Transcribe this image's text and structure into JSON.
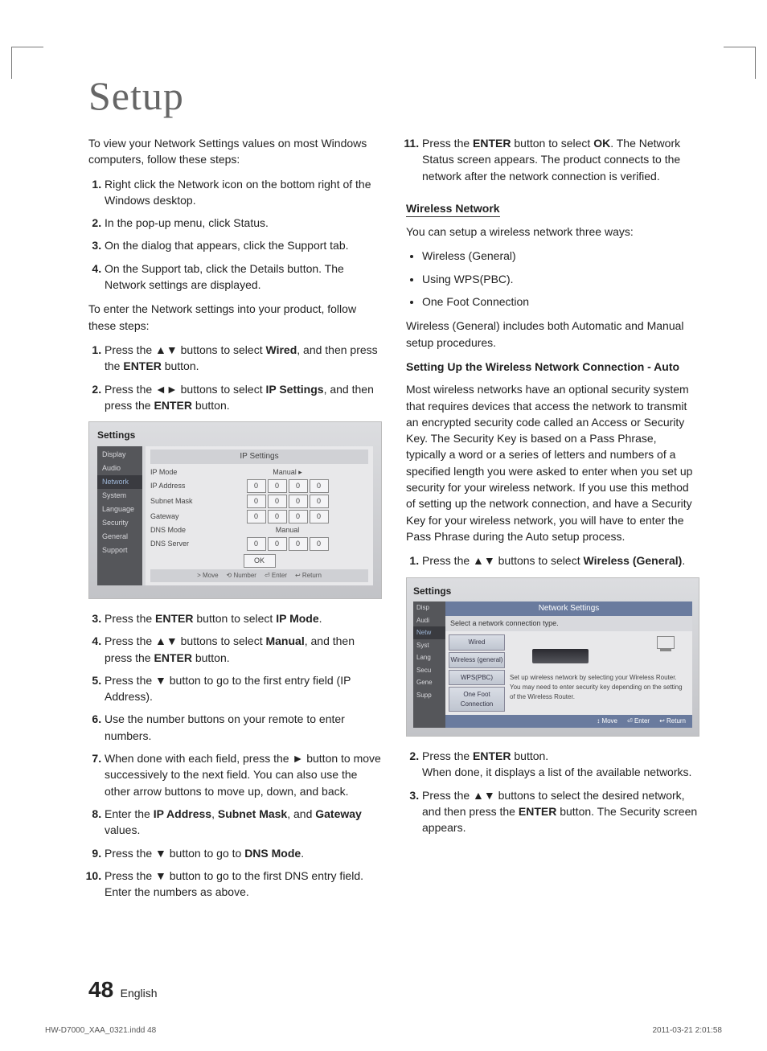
{
  "title": "Setup",
  "left": {
    "intro": "To view your Network Settings values on most Windows computers, follow these steps:",
    "steps_a": [
      "Right click the Network icon on the bottom right of the Windows desktop.",
      "In the pop-up menu, click Status.",
      "On the dialog that appears, click the Support tab.",
      "On the Support tab, click the Details button. The Network settings are displayed."
    ],
    "intro2": "To enter the Network settings into your product, follow these steps:",
    "step_b1_a": "Press the ▲▼ buttons to select ",
    "step_b1_b": "Wired",
    "step_b1_c": ", and then press the ",
    "step_b1_d": "ENTER",
    "step_b1_e": " button.",
    "step_b2_a": "Press the ◄► buttons to select ",
    "step_b2_b": "IP Settings",
    "step_b2_c": ", and then press the ",
    "step_b2_d": "ENTER",
    "step_b2_e": " button.",
    "step_b3_a": "Press the ",
    "step_b3_b": "ENTER",
    "step_b3_c": " button to select ",
    "step_b3_d": "IP Mode",
    "step_b3_e": ".",
    "step_b4_a": "Press the ▲▼ buttons to select ",
    "step_b4_b": "Manual",
    "step_b4_c": ", and then press the ",
    "step_b4_d": "ENTER",
    "step_b4_e": " button.",
    "step_b5": "Press the ▼ button to go to the first entry field (IP Address).",
    "step_b6": "Use the number buttons on your remote to enter numbers.",
    "step_b7": "When done with each field, press the ► button to move successively to the next field. You can also use the other arrow buttons to move up, down, and back.",
    "step_b8_a": "Enter the ",
    "step_b8_b": "IP Address",
    "step_b8_c": ", ",
    "step_b8_d": "Subnet Mask",
    "step_b8_e": ", and ",
    "step_b8_f": "Gateway",
    "step_b8_g": " values.",
    "step_b9_a": "Press the ▼ button to go to ",
    "step_b9_b": "DNS Mode",
    "step_b9_c": ".",
    "step_b10": "Press the ▼ button to go to the first DNS entry field. Enter the numbers as above."
  },
  "right": {
    "step11_a": "Press the ",
    "step11_b": "ENTER",
    "step11_c": " button to select ",
    "step11_d": "OK",
    "step11_e": ". The Network Status screen appears. The product connects to the network after the network connection is verified.",
    "wireless_head": "Wireless Network",
    "wireless_intro": "You can setup a wireless network three ways:",
    "wireless_opts": [
      "Wireless (General)",
      "Using WPS(PBC).",
      "One Foot Connection"
    ],
    "wireless_note": "Wireless (General) includes both Automatic and Manual setup procedures.",
    "auto_head": "Setting Up the Wireless Network Connection - Auto",
    "auto_para": "Most wireless networks have an optional security system that requires devices that access the network to transmit an encrypted security code called an Access or Security Key. The Security Key is based on a Pass Phrase, typically a word or a series of letters and numbers of a specified length you were asked to enter when you set up security for your wireless network. If you use this method of setting up the network connection, and have a Security Key for your wireless network, you will have to enter the Pass Phrase during the Auto setup process.",
    "a1_a": "Press the ▲▼ buttons to select ",
    "a1_b": "Wireless (General)",
    "a1_c": ".",
    "a2_a": "Press the ",
    "a2_b": "ENTER",
    "a2_c": " button.",
    "a2_d": "When done, it displays a list of the available networks.",
    "a3_a": "Press the ▲▼ buttons to select the desired network, and then press the ",
    "a3_b": "ENTER",
    "a3_c": " button. The Security screen appears."
  },
  "screenshot1": {
    "title": "Settings",
    "header": "IP Settings",
    "side": [
      "Display",
      "Audio",
      "Network",
      "System",
      "Language",
      "Security",
      "General",
      "Support"
    ],
    "rows": [
      {
        "label": "IP Mode",
        "val": "Manual",
        "type": "text",
        "arrow": "▸"
      },
      {
        "label": "IP Address",
        "type": "ip"
      },
      {
        "label": "Subnet Mask",
        "type": "ip"
      },
      {
        "label": "Gateway",
        "type": "ip"
      },
      {
        "label": "DNS Mode",
        "val": "Manual",
        "type": "text"
      },
      {
        "label": "DNS Server",
        "type": "ip"
      }
    ],
    "ok": "OK",
    "hints": [
      "> Move",
      "⟲ Number",
      "⏎ Enter",
      "↩ Return"
    ]
  },
  "screenshot2": {
    "title": "Settings",
    "header": "Network Settings",
    "sub": "Select a network connection type.",
    "side": [
      "Disp",
      "Audi",
      "Netw",
      "Syst",
      "Lang",
      "Secu",
      "Gene",
      "Supp"
    ],
    "opts": [
      "Wired",
      "Wireless (general)",
      "WPS(PBC)",
      "One Foot Connection"
    ],
    "desc": "Set up wireless network by selecting your Wireless Router. You may need to enter security key depending on the setting of the Wireless Router.",
    "footer": [
      "↕ Move",
      "⏎ Enter",
      "↩ Return"
    ]
  },
  "page_number": "48",
  "page_lang": "English",
  "footer_left": "HW-D7000_XAA_0321.indd   48",
  "footer_right": "2011-03-21   2:01:58"
}
